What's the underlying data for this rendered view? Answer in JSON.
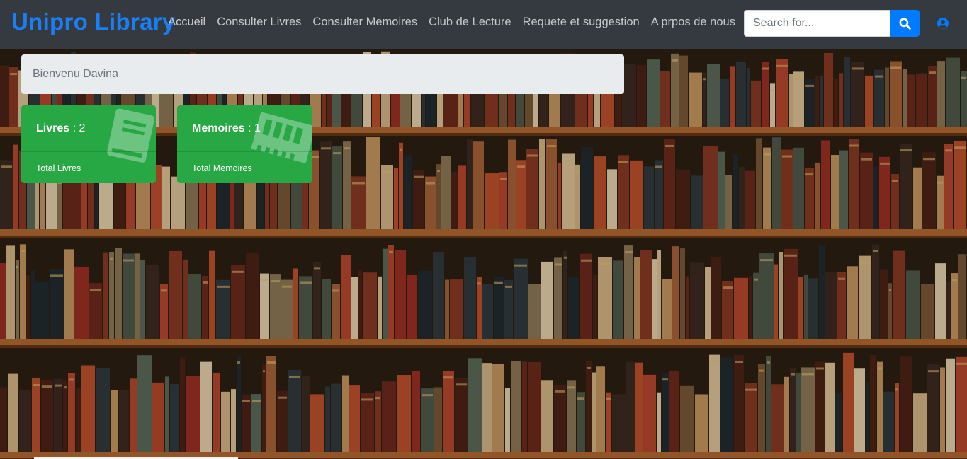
{
  "brand": "Unipro Library",
  "nav": [
    {
      "label": "Accueil"
    },
    {
      "label": "Consulter Livres"
    },
    {
      "label": "Consulter Memoires"
    },
    {
      "label": "Club de Lecture"
    },
    {
      "label": "Requete et suggestion"
    },
    {
      "label": "A prpos de nous"
    }
  ],
  "search": {
    "placeholder": "Search for...",
    "value": ""
  },
  "icons": {
    "search": "search-icon",
    "user": "user-circle-icon",
    "book": "book-icon",
    "memoire": "memory-icon"
  },
  "colors": {
    "navbar": "#343a40",
    "brand": "#1a7ff5",
    "accent": "#007bff",
    "card": "#28a745"
  },
  "welcome": "Bienvenu Davina",
  "cards": [
    {
      "title": "Livres",
      "sep": " : ",
      "count": "2",
      "footer": "Total Livres"
    },
    {
      "title": "Memoires",
      "sep": " : ",
      "count": "1",
      "footer": "Total Memoires"
    }
  ]
}
